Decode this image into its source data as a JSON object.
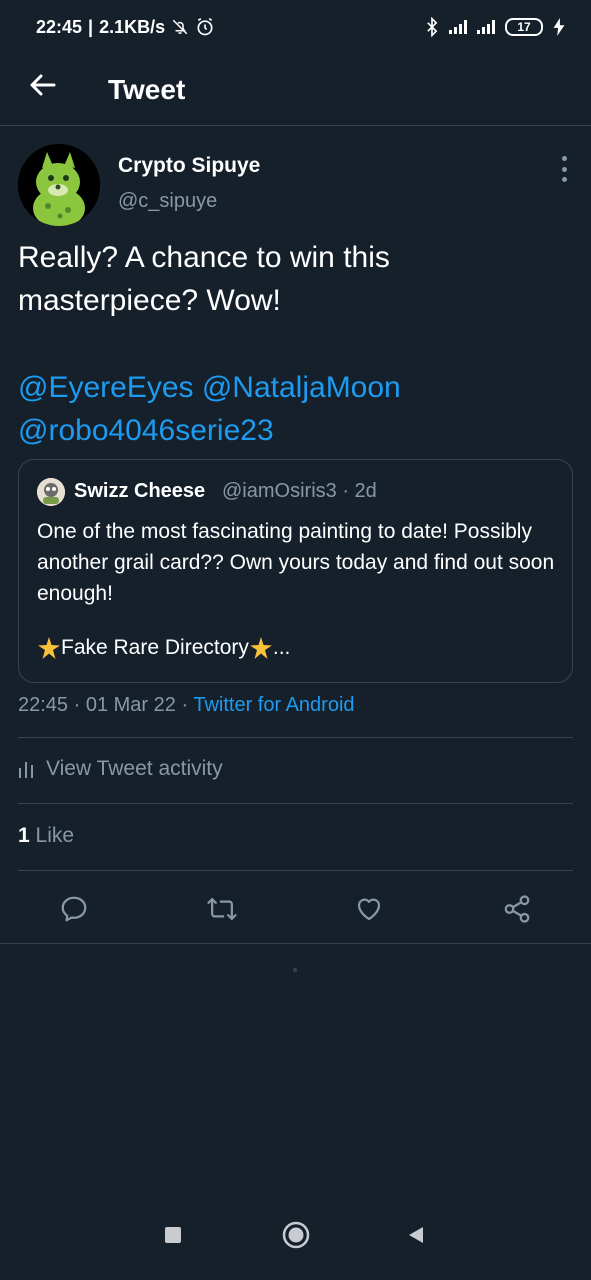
{
  "status_bar": {
    "time": "22:45",
    "speed": "2.1KB/s",
    "battery": "17",
    "icons": [
      "bell-off-icon",
      "alarm-icon",
      "bluetooth-icon",
      "signal-icon",
      "signal-icon",
      "charging-icon"
    ]
  },
  "header": {
    "title": "Tweet"
  },
  "tweet": {
    "author_name": "Crypto Sipuye",
    "author_handle": "@c_sipuye",
    "text": "Really? A chance to win this masterpiece? Wow!",
    "mentions_line1": "@EyereEyes @NataljaMoon",
    "mentions_line2": "@robo4046serie23",
    "time": "22:45",
    "date": "01 Mar 22",
    "source": "Twitter for Android",
    "activity_label": "View Tweet activity",
    "likes_count": "1",
    "likes_label": "Like"
  },
  "quote": {
    "name": "Swizz Cheese",
    "handle": "@iamOsiris3",
    "age": "2d",
    "text": "One of the most fascinating painting to date! Possibly another grail card?? Own yours today and find out soon enough!",
    "footer_text": "Fake Rare Directory",
    "ellipsis": "..."
  },
  "colors": {
    "background": "#15202b",
    "accent": "#1d9bf0",
    "muted": "#8899a6",
    "divider": "#38444d"
  }
}
